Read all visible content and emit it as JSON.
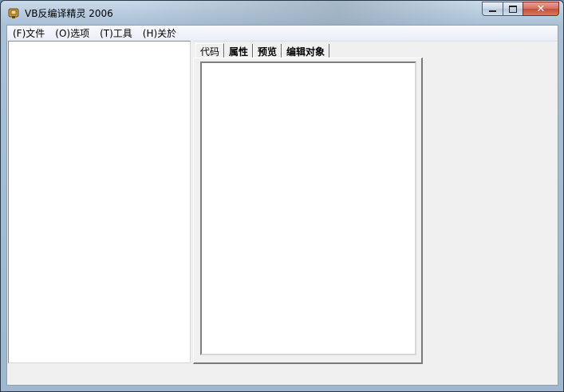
{
  "window": {
    "title": "VB反编译精灵 2006",
    "icon": "app-icon"
  },
  "caption_buttons": {
    "minimize": "minimize-icon",
    "maximize": "maximize-icon",
    "close": "close-icon"
  },
  "menu": {
    "items": [
      {
        "label": "(F)文件"
      },
      {
        "label": "(O)选项"
      },
      {
        "label": "(T)工具"
      },
      {
        "label": "(H)关於"
      }
    ]
  },
  "tabs": [
    {
      "label": "代码",
      "active": true
    },
    {
      "label": "属性",
      "active": false
    },
    {
      "label": "预览",
      "active": false
    },
    {
      "label": "编辑对象",
      "active": false
    }
  ],
  "colors": {
    "client_bg": "#f0f0f0",
    "pane_bg": "#ffffff",
    "close_button": "#c44d38"
  }
}
